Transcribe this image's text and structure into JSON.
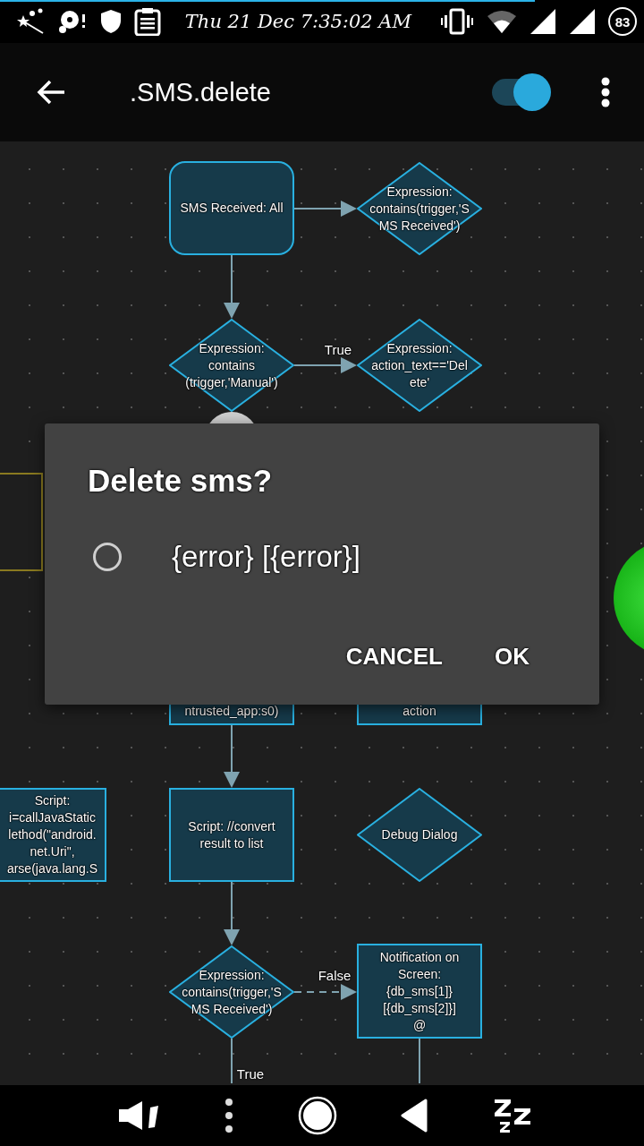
{
  "status_bar": {
    "time": "Thu 21 Dec 7:35:02 AM",
    "battery": "83"
  },
  "toolbar": {
    "title": ".SMS.delete",
    "enabled": true
  },
  "flowchart": {
    "nodes": [
      {
        "kind": "trigger",
        "text": "SMS Received: All"
      },
      {
        "kind": "decision",
        "text": "Expression:\ncontains(trigger,'S\nMS Received')"
      },
      {
        "kind": "decision",
        "text": "Expression:\ncontains\n(trigger,'Manual')"
      },
      {
        "kind": "decision",
        "text": "Expression:\naction_text=='Del\nete'"
      },
      {
        "kind": "action",
        "text": "ntrusted_app:s0)"
      },
      {
        "kind": "action",
        "text": "action"
      },
      {
        "kind": "action",
        "text": "Script:\ni=callJavaStatic\nlethod(\"android.\nnet.Uri\",\narse(java.lang.S"
      },
      {
        "kind": "action",
        "text": "Script: //convert\nresult to list"
      },
      {
        "kind": "decision",
        "text": "Debug Dialog"
      },
      {
        "kind": "decision",
        "text": "Expression:\ncontains(trigger,'S\nMS Received')"
      },
      {
        "kind": "action",
        "text": "Notification on\nScreen:\n{db_sms[1]}\n[{db_sms[2]}]\n@"
      }
    ],
    "edges": [
      {
        "kind": "solid"
      },
      {
        "kind": "solid"
      },
      {
        "kind": "solid",
        "label": "True"
      },
      {
        "kind": "solid"
      },
      {
        "kind": "solid"
      },
      {
        "kind": "dashed",
        "label": "False"
      },
      {
        "kind": "solid",
        "label": "True"
      },
      {
        "kind": "solid"
      }
    ]
  },
  "dialog": {
    "title": "Delete sms?",
    "options": [
      {
        "label": "{error} [{error}]",
        "selected": false
      }
    ],
    "buttons": [
      "CANCEL",
      "OK"
    ]
  }
}
